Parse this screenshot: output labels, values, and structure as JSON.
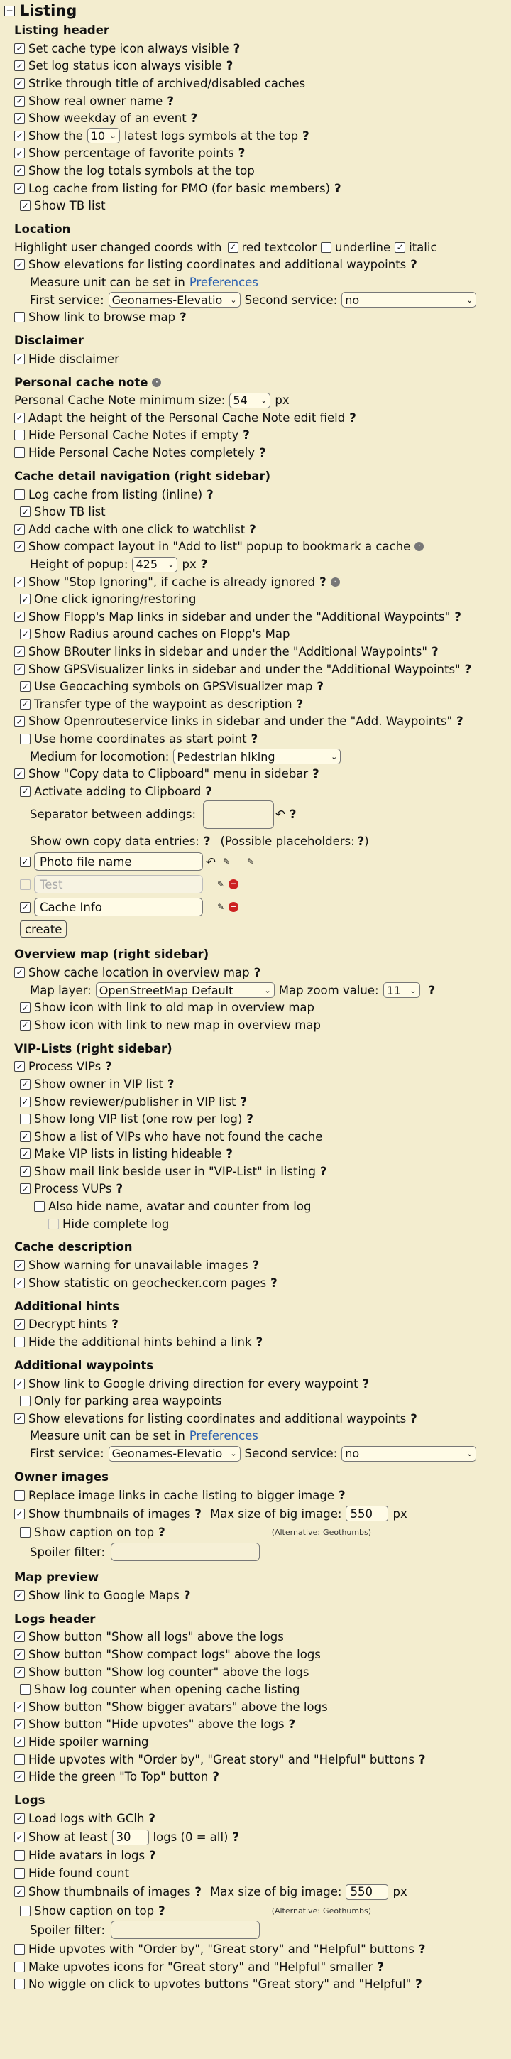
{
  "page_title": "Listing",
  "sections": {
    "listing_header": {
      "title": "Listing header",
      "items": [
        "Set cache type icon always visible",
        "Set log status icon always visible",
        "Strike through title of archived/disabled caches",
        "Show real owner name",
        "Show weekday of an event",
        "Show percentage of favorite points",
        "Show the log totals symbols at the top",
        "Log cache from listing for PMO (for basic members)",
        "Show TB list"
      ],
      "latest_logs_pre": "Show the",
      "latest_logs_value": "10",
      "latest_logs_post": "latest logs symbols at the top"
    },
    "location": {
      "title": "Location",
      "highlight_label": "Highlight user changed coords with",
      "red_textcolor": "red textcolor",
      "underline": "underline",
      "italic": "italic",
      "show_elevations": "Show elevations for listing coordinates and additional waypoints",
      "measure_unit": "Measure unit can be set in",
      "preferences": "Preferences",
      "first_service": "First service:",
      "first_service_value": "Geonames-Elevatio",
      "second_service": "Second service:",
      "second_service_value": "no",
      "browse_map": "Show link to browse map"
    },
    "disclaimer": {
      "title": "Disclaimer",
      "hide": "Hide disclaimer"
    },
    "personal_note": {
      "title": "Personal cache note",
      "min_size_label": "Personal Cache Note minimum size:",
      "min_size_value": "54",
      "unit": "px",
      "adapt": "Adapt the height of the Personal Cache Note edit field",
      "hide_if_empty": "Hide Personal Cache Notes if empty",
      "hide_completely": "Hide Personal Cache Notes completely"
    },
    "detail_nav": {
      "title": "Cache detail navigation (right sidebar)",
      "log_inline": "Log cache from listing (inline)",
      "show_tb": "Show TB list",
      "watchlist": "Add cache with one click to watchlist",
      "compact": "Show compact layout in \"Add to list\" popup to bookmark a cache",
      "popup_height": "Height of popup:",
      "popup_value": "425",
      "px": "px",
      "stop_ignoring": "Show \"Stop Ignoring\", if cache is already ignored",
      "one_click": "One click ignoring/restoring",
      "flopp": "Show Flopp's Map links in sidebar and under the \"Additional Waypoints\"",
      "radius": "Show Radius around caches on Flopp's Map",
      "brouter": "Show BRouter links in sidebar and under the \"Additional Waypoints\"",
      "gpsvis": "Show GPSVisualizer links in sidebar and under the \"Additional Waypoints\"",
      "geocaching_symbols": "Use Geocaching symbols on GPSVisualizer map",
      "transfer_type": "Transfer type of the waypoint as description",
      "openroute": "Show Openrouteservice links in sidebar and under the \"Add. Waypoints\"",
      "home_coords": "Use home coordinates as start point",
      "medium_label": "Medium for locomotion:",
      "medium_value": "Pedestrian hiking",
      "copy_menu": "Show \"Copy data to Clipboard\" menu in sidebar",
      "activate_adding": "Activate adding to Clipboard",
      "separator": "Separator between addings:",
      "own_entries": "Show own copy data entries:",
      "placeholders": "(Possible placeholders:",
      "entries": [
        "Photo file name",
        "Test",
        "Cache Info"
      ],
      "create": "create"
    },
    "overview_map": {
      "title": "Overview map (right sidebar)",
      "show_location": "Show cache location in overview map",
      "layer_label": "Map layer:",
      "layer_value": "OpenStreetMap Default",
      "zoom_label": "Map zoom value:",
      "zoom_value": "11",
      "old_map": "Show icon with link to old map in overview map",
      "new_map": "Show icon with link to new map in overview map"
    },
    "vip": {
      "title": "VIP-Lists (right sidebar)",
      "process": "Process VIPs",
      "owner": "Show owner in VIP list",
      "reviewer": "Show reviewer/publisher in VIP list",
      "long": "Show long VIP list (one row per log)",
      "not_found": "Show a list of VIPs who have not found the cache",
      "hideable": "Make VIP lists in listing hideable",
      "mail": "Show mail link beside user in \"VIP-List\" in listing",
      "vups": "Process VUPs",
      "also_hide": "Also hide name, avatar and counter from log",
      "hide_complete": "Hide complete log"
    },
    "cache_description": {
      "title": "Cache description",
      "warning": "Show warning for unavailable images",
      "statistic": "Show statistic on geochecker.com pages"
    },
    "hints": {
      "title": "Additional hints",
      "decrypt": "Decrypt hints",
      "hide_link": "Hide the additional hints behind a link"
    },
    "waypoints": {
      "title": "Additional waypoints",
      "driving": "Show link to Google driving direction for every waypoint",
      "parking": "Only for parking area waypoints",
      "elevations": "Show elevations for listing coordinates and additional waypoints",
      "measure_unit": "Measure unit can be set in",
      "preferences": "Preferences",
      "first_service": "First service:",
      "first_service_value": "Geonames-Elevatio",
      "second_service": "Second service:",
      "second_service_value": "no"
    },
    "owner_images": {
      "title": "Owner images",
      "replace": "Replace image links in cache listing to bigger image",
      "thumbnails": "Show thumbnails of images",
      "max_size": "Max size of big image:",
      "max_value": "550",
      "px": "px",
      "caption": "Show caption on top",
      "alternative": "(Alternative:",
      "geothumbs": "Geothumbs",
      "alt_close": ")",
      "spoiler": "Spoiler filter:"
    },
    "map_preview": {
      "title": "Map preview",
      "google": "Show link to Google Maps"
    },
    "logs_header": {
      "title": "Logs header",
      "all_logs": "Show button \"Show all logs\" above the logs",
      "compact": "Show button \"Show compact logs\" above the logs",
      "counter": "Show button \"Show log counter\" above the logs",
      "counter_open": "Show log counter when opening cache listing",
      "bigger": "Show button \"Show bigger avatars\" above the logs",
      "hide_upvotes": "Show button \"Hide upvotes\" above the logs",
      "spoiler": "Hide spoiler warning",
      "upvotes_order": "Hide upvotes with \"Order by\", \"Great story\" and \"Helpful\" buttons",
      "to_top": "Hide the green \"To Top\" button"
    },
    "logs": {
      "title": "Logs",
      "load": "Load logs with GClh",
      "at_least_pre": "Show at least",
      "at_least_value": "30",
      "at_least_post": "logs (0 = all)",
      "avatars": "Hide avatars in logs",
      "found_count": "Hide found count",
      "thumbnails": "Show thumbnails of images",
      "max_size": "Max size of big image:",
      "max_value": "550",
      "px": "px",
      "caption": "Show caption on top",
      "alternative": "(Alternative:",
      "geothumbs": "Geothumbs",
      "alt_close": ")",
      "spoiler": "Spoiler filter:",
      "hide_upvotes": "Hide upvotes with \"Order by\", \"Great story\" and \"Helpful\" buttons",
      "smaller": "Make upvotes icons for \"Great story\" and \"Helpful\" smaller",
      "no_wiggle": "No wiggle on click to upvotes buttons \"Great story\" and \"Helpful\""
    }
  }
}
